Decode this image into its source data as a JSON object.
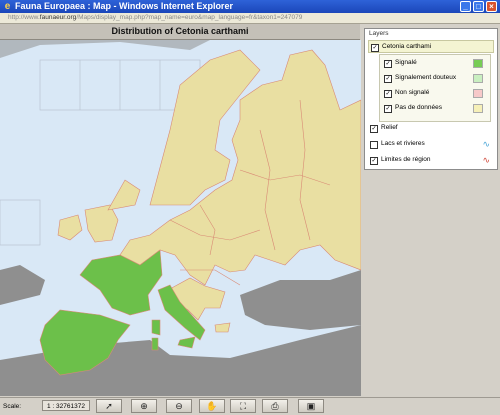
{
  "window": {
    "title": "Fauna Europaea : Map - Windows Internet Explorer"
  },
  "address": {
    "prefix": "http://www.",
    "domain": "faunaeur.org",
    "path": "/Maps/display_map.php?map_name=euro&map_language=fr&taxon1=247079"
  },
  "map": {
    "title": "Distribution of Cetonia carthami"
  },
  "layers": {
    "title": "Layers",
    "main_layer": "Cetonia carthami",
    "sub_items": [
      {
        "label": "Signalé",
        "color": "#77cc55"
      },
      {
        "label": "Signalement douteux",
        "color": "#c9efc0"
      },
      {
        "label": "Non signalé",
        "color": "#f7c9c9"
      },
      {
        "label": "Pas de données",
        "color": "#f6f0b8"
      }
    ],
    "relief": "Relief",
    "lakes": "Lacs et rivieres",
    "borders": "Limites de région"
  },
  "toolbar": {
    "scale_label": "Scale:",
    "scale_value": "1 : 32761372"
  },
  "colors": {
    "present": "#6cc04a",
    "no_data": "#e9dfa2",
    "sea": "#d9e8f6",
    "border": "#d98a75",
    "relief": "#8f8f8f"
  }
}
